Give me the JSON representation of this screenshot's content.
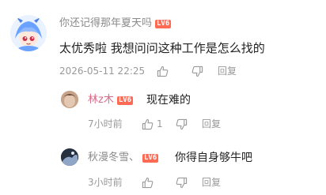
{
  "main_comment": {
    "username": "你还记得那年夏天吗",
    "level": "LV6",
    "content": "太优秀啦 我想问问这种工作是怎么找的",
    "timestamp": "2026-05-11 22:25",
    "reply_label": "回复",
    "colors": {
      "username": "#8a8a8a",
      "level_badge": "#ff6a55"
    }
  },
  "replies": [
    {
      "username": "林z木",
      "level": "LV6",
      "content": "现在难的",
      "timestamp": "7小时前",
      "like_count": "1",
      "reply_label": "回复",
      "colors": {
        "username": "#d96a8a"
      }
    },
    {
      "username": "秋漫冬雪、",
      "level": "LV6",
      "content": "你得自身够牛吧",
      "timestamp": "3小时前",
      "reply_label": "回复",
      "colors": {
        "username": "#8a8a8a"
      }
    }
  ]
}
